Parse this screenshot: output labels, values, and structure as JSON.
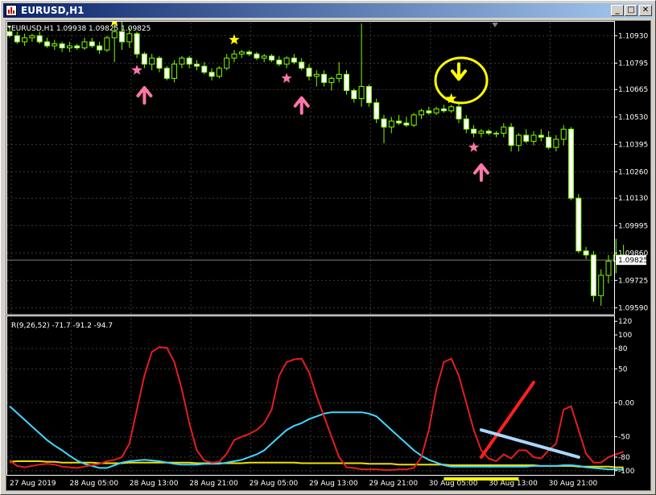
{
  "window": {
    "title": "EURUSD,H1",
    "icon": "chart-app-icon",
    "buttons": [
      {
        "name": "minimize-button",
        "glyph": "_"
      },
      {
        "name": "maximize-button",
        "glyph": "□"
      },
      {
        "name": "close-button",
        "glyph": "✕"
      }
    ]
  },
  "main_chart": {
    "header": "EURUSD,H1  1.09938 1.09825 1.09825",
    "price_levels": [
      "1.10930",
      "1.10795",
      "1.10665",
      "1.10530",
      "1.10395",
      "1.10260",
      "1.10130",
      "1.09995",
      "1.09860",
      "1.09725",
      "1.09590"
    ],
    "current_price": "1.09825",
    "candle_color": "#7cfc00",
    "candle_bear_color": "#ffffff",
    "candles": [
      [
        1.1095,
        1.1098,
        1.1092,
        1.1093
      ],
      [
        1.1093,
        1.1095,
        1.1089,
        1.109
      ],
      [
        1.109,
        1.1094,
        1.1088,
        1.1092
      ],
      [
        1.1092,
        1.1094,
        1.109,
        1.1093
      ],
      [
        1.1093,
        1.1095,
        1.1089,
        1.109
      ],
      [
        1.109,
        1.1092,
        1.1087,
        1.1088
      ],
      [
        1.1088,
        1.1091,
        1.1086,
        1.1089
      ],
      [
        1.1089,
        1.109,
        1.1085,
        1.1087
      ],
      [
        1.1087,
        1.109,
        1.1085,
        1.1088
      ],
      [
        1.1088,
        1.1089,
        1.1086,
        1.1087
      ],
      [
        1.1087,
        1.1092,
        1.1086,
        1.109
      ],
      [
        1.109,
        1.1092,
        1.1087,
        1.1088
      ],
      [
        1.1088,
        1.109,
        1.1084,
        1.1086
      ],
      [
        1.1086,
        1.1093,
        1.1085,
        1.1092
      ],
      [
        1.1092,
        1.11,
        1.108,
        1.1095
      ],
      [
        1.1095,
        1.11,
        1.1086,
        1.109
      ],
      [
        1.109,
        1.1097,
        1.1087,
        1.1094
      ],
      [
        1.1094,
        1.1095,
        1.1082,
        1.1084
      ],
      [
        1.1084,
        1.1085,
        1.1077,
        1.1079
      ],
      [
        1.1079,
        1.1084,
        1.1076,
        1.1082
      ],
      [
        1.1082,
        1.1083,
        1.1075,
        1.1077
      ],
      [
        1.1077,
        1.1078,
        1.1071,
        1.1072
      ],
      [
        1.1072,
        1.1081,
        1.107,
        1.1079
      ],
      [
        1.1079,
        1.1083,
        1.1077,
        1.1082
      ],
      [
        1.1082,
        1.1083,
        1.1077,
        1.1079
      ],
      [
        1.1079,
        1.1081,
        1.1076,
        1.1078
      ],
      [
        1.1078,
        1.108,
        1.1074,
        1.1075
      ],
      [
        1.1075,
        1.1077,
        1.1071,
        1.1073
      ],
      [
        1.1073,
        1.1078,
        1.1072,
        1.1077
      ],
      [
        1.1077,
        1.1084,
        1.1076,
        1.1082
      ],
      [
        1.1082,
        1.1086,
        1.108,
        1.1084
      ],
      [
        1.1084,
        1.1086,
        1.1082,
        1.1085
      ],
      [
        1.1085,
        1.1086,
        1.1083,
        1.1084
      ],
      [
        1.1084,
        1.1085,
        1.1081,
        1.1082
      ],
      [
        1.1082,
        1.1084,
        1.108,
        1.1083
      ],
      [
        1.1083,
        1.1084,
        1.108,
        1.1081
      ],
      [
        1.1081,
        1.1083,
        1.1078,
        1.1079
      ],
      [
        1.1079,
        1.1083,
        1.1077,
        1.1082
      ],
      [
        1.1082,
        1.1084,
        1.1079,
        1.108
      ],
      [
        1.108,
        1.1082,
        1.1076,
        1.1077
      ],
      [
        1.1077,
        1.1079,
        1.1071,
        1.1073
      ],
      [
        1.1073,
        1.1076,
        1.1068,
        1.1074
      ],
      [
        1.1074,
        1.1076,
        1.1068,
        1.107
      ],
      [
        1.107,
        1.1073,
        1.1066,
        1.1072
      ],
      [
        1.1072,
        1.108,
        1.107,
        1.1074
      ],
      [
        1.1074,
        1.1076,
        1.1064,
        1.1066
      ],
      [
        1.1066,
        1.1067,
        1.106,
        1.1062
      ],
      [
        1.1062,
        1.1099,
        1.1058,
        1.1068
      ],
      [
        1.1068,
        1.1069,
        1.1058,
        1.106
      ],
      [
        1.106,
        1.1062,
        1.105,
        1.1052
      ],
      [
        1.1052,
        1.1054,
        1.104,
        1.1048
      ],
      [
        1.1048,
        1.1053,
        1.1045,
        1.1051
      ],
      [
        1.1051,
        1.1054,
        1.1049,
        1.105
      ],
      [
        1.105,
        1.1053,
        1.1048,
        1.1049
      ],
      [
        1.1049,
        1.1055,
        1.1048,
        1.1054
      ],
      [
        1.1054,
        1.1057,
        1.1052,
        1.1056
      ],
      [
        1.1056,
        1.1058,
        1.1054,
        1.1055
      ],
      [
        1.1055,
        1.1058,
        1.1054,
        1.1057
      ],
      [
        1.1057,
        1.1059,
        1.1055,
        1.1056
      ],
      [
        1.1056,
        1.1059,
        1.1055,
        1.1058
      ],
      [
        1.1058,
        1.106,
        1.105,
        1.1052
      ],
      [
        1.1052,
        1.1054,
        1.1045,
        1.1047
      ],
      [
        1.1047,
        1.1049,
        1.1043,
        1.1045
      ],
      [
        1.1045,
        1.1047,
        1.1043,
        1.1046
      ],
      [
        1.1046,
        1.1047,
        1.1044,
        1.1045
      ],
      [
        1.1045,
        1.1046,
        1.1043,
        1.1045
      ],
      [
        1.1045,
        1.105,
        1.1043,
        1.1048
      ],
      [
        1.1048,
        1.105,
        1.1036,
        1.1039
      ],
      [
        1.1039,
        1.1045,
        1.1036,
        1.1044
      ],
      [
        1.1044,
        1.1047,
        1.104,
        1.1041
      ],
      [
        1.1041,
        1.1046,
        1.1039,
        1.1044
      ],
      [
        1.1044,
        1.1047,
        1.1041,
        1.1043
      ],
      [
        1.1043,
        1.1046,
        1.1037,
        1.1038
      ],
      [
        1.1038,
        1.1044,
        1.1036,
        1.1042
      ],
      [
        1.1042,
        1.1049,
        1.1039,
        1.1047
      ],
      [
        1.1047,
        1.1048,
        1.1012,
        1.1013
      ],
      [
        1.1013,
        1.1015,
        1.0986,
        1.0987
      ],
      [
        1.0987,
        1.0989,
        1.0983,
        1.0985
      ],
      [
        1.0985,
        1.0987,
        1.0962,
        1.0965
      ],
      [
        1.0965,
        1.0978,
        1.096,
        1.0975
      ],
      [
        1.0975,
        1.0985,
        1.0971,
        1.0982
      ],
      [
        1.0982,
        1.0993,
        1.0976,
        1.0985
      ],
      [
        1.0985,
        1.099,
        1.0982,
        1.0983
      ]
    ]
  },
  "markers": {
    "yellow_stars": [
      {
        "index": 14,
        "price": 1.11
      },
      {
        "index": 30,
        "price": 1.1091
      },
      {
        "index": 59,
        "price": 1.1062
      }
    ],
    "pink_stars": [
      {
        "index": 17,
        "price": 1.1076
      },
      {
        "index": 37,
        "price": 1.1072
      },
      {
        "index": 62,
        "price": 1.1038
      }
    ],
    "yellow_down_arrows": [
      {
        "index": 30,
        "price": 1.1104
      },
      {
        "index": 60,
        "price": 1.1072
      }
    ],
    "pink_up_arrows": [
      {
        "index": 18,
        "price": 1.1067
      },
      {
        "index": 39,
        "price": 1.1062
      },
      {
        "index": 63,
        "price": 1.1029
      }
    ],
    "highlight_circle": {
      "index": 60,
      "price": 1.1071
    },
    "colors": {
      "yellow": "#ffff00",
      "pink": "#ff77aa"
    }
  },
  "indicator": {
    "header": "R(9,26,52) -71.7 -91.2 -94.7",
    "levels": [
      "120",
      "100",
      "80",
      "50",
      "0.00",
      "-50",
      "-80",
      "-100"
    ],
    "series": [
      {
        "name": "red",
        "color": "#e31e1e",
        "values": [
          -85,
          -93,
          -95,
          -93,
          -91,
          -90,
          -91,
          -94,
          -95,
          -96,
          -94,
          -92,
          -90,
          -86,
          -84,
          -80,
          -60,
          -10,
          40,
          75,
          82,
          81,
          60,
          20,
          -30,
          -70,
          -85,
          -88,
          -87,
          -75,
          -55,
          -50,
          -46,
          -40,
          -30,
          -10,
          40,
          60,
          64,
          65,
          45,
          10,
          -20,
          -50,
          -80,
          -95,
          -96,
          -98,
          -98,
          -98,
          -99,
          -99,
          -98,
          -98,
          -96,
          -80,
          -40,
          20,
          60,
          65,
          40,
          0,
          -40,
          -70,
          -82,
          -86,
          -76,
          -82,
          -70,
          -70,
          -80,
          -82,
          -70,
          -60,
          -10,
          -5,
          -40,
          -75,
          -88,
          -88,
          -80,
          -76,
          -72
        ]
      },
      {
        "name": "cyan",
        "color": "#40d8ff",
        "values": [
          -5,
          -15,
          -25,
          -35,
          -45,
          -55,
          -63,
          -70,
          -78,
          -85,
          -90,
          -93,
          -96,
          -96,
          -92,
          -88,
          -86,
          -85,
          -84,
          -85,
          -86,
          -88,
          -90,
          -91,
          -91,
          -91,
          -90,
          -90,
          -90,
          -88,
          -86,
          -84,
          -80,
          -76,
          -70,
          -60,
          -50,
          -40,
          -34,
          -30,
          -24,
          -20,
          -16,
          -14,
          -14,
          -14,
          -14,
          -14,
          -16,
          -20,
          -30,
          -40,
          -50,
          -60,
          -70,
          -78,
          -84,
          -88,
          -92,
          -94,
          -94,
          -94,
          -94,
          -94,
          -94,
          -94,
          -94,
          -94,
          -94,
          -94,
          -93,
          -93,
          -93,
          -93,
          -92,
          -92,
          -93,
          -95,
          -96,
          -97,
          -98,
          -98,
          -99
        ]
      },
      {
        "name": "yellow",
        "color": "#f0e000",
        "values": [
          -87,
          -86,
          -86,
          -86,
          -86,
          -87,
          -87,
          -88,
          -88,
          -88,
          -88,
          -88,
          -89,
          -89,
          -89,
          -89,
          -88,
          -88,
          -88,
          -88,
          -88,
          -88,
          -88,
          -88,
          -88,
          -89,
          -89,
          -89,
          -89,
          -89,
          -89,
          -89,
          -88,
          -88,
          -88,
          -88,
          -88,
          -88,
          -88,
          -89,
          -89,
          -89,
          -89,
          -89,
          -89,
          -89,
          -89,
          -89,
          -90,
          -90,
          -90,
          -90,
          -91,
          -91,
          -91,
          -91,
          -91,
          -91,
          -91,
          -92,
          -92,
          -92,
          -92,
          -92,
          -92,
          -92,
          -92,
          -92,
          -92,
          -92,
          -92,
          -93,
          -93,
          -93,
          -93,
          -93,
          -94,
          -94,
          -94,
          -94,
          -94,
          -95,
          -95
        ]
      }
    ],
    "annotations": [
      {
        "name": "red-trend-line",
        "color": "#ff2020",
        "from": [
          63,
          -80
        ],
        "to": [
          70,
          30
        ]
      },
      {
        "name": "cyan-trend-line",
        "color": "#a8d8ff",
        "from": [
          63,
          -40
        ],
        "to": [
          76,
          -80
        ]
      }
    ],
    "time_highlight_color": "#ffff00"
  },
  "time_axis": {
    "labels": [
      "27 Aug 2019",
      "28 Aug 05:00",
      "28 Aug 13:00",
      "28 Aug 21:00",
      "29 Aug 05:00",
      "29 Aug 13:00",
      "29 Aug 21:00",
      "30 Aug 05:00",
      "30 Aug 13:00",
      "30 Aug 21:00"
    ]
  },
  "colors": {
    "background": "#000000",
    "grid": "#3a3a3a",
    "axis_text": "#ffffff",
    "current_price_bg": "#ffffff"
  }
}
